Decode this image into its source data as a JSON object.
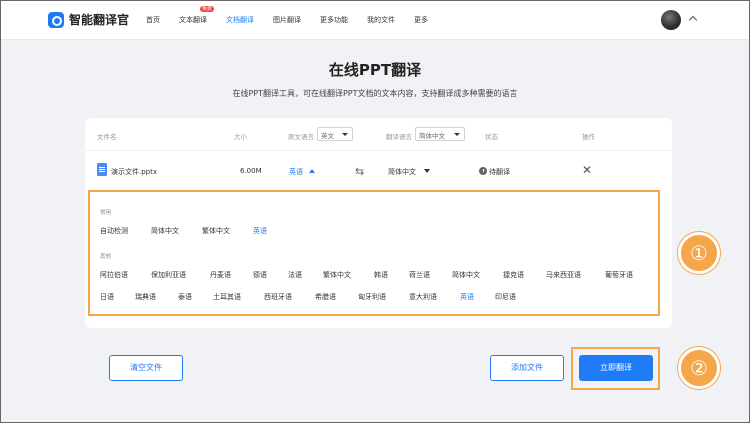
{
  "brand": {
    "name": "智能翻译官"
  },
  "nav": [
    {
      "label": "首页"
    },
    {
      "label": "文本翻译",
      "badge": "免费"
    },
    {
      "label": "文档翻译",
      "active": true
    },
    {
      "label": "图片翻译"
    },
    {
      "label": "更多功能"
    },
    {
      "label": "我的文件"
    },
    {
      "label": "更多"
    }
  ],
  "page": {
    "title": "在线PPT翻译",
    "subtitle": "在线PPT翻译工具，可在线翻译PPT文档的文本内容，支持翻译成多种需要的语言"
  },
  "table": {
    "headers": {
      "filename": "文件名",
      "size": "大小",
      "source_lang": "原文语言",
      "source_value": "英文",
      "target_lang": "翻译语言",
      "target_value": "简体中文",
      "status": "状态",
      "action": "操作"
    },
    "row": {
      "filename": "演示文件.pptx",
      "size": "6.00M",
      "source": "英语",
      "target": "简体中文",
      "status": "待翻译"
    }
  },
  "languages": {
    "common_label": "常用",
    "common": [
      "自动检测",
      "简体中文",
      "繁体中文",
      "英语"
    ],
    "other_label": "其他",
    "other_row1": [
      "阿拉伯语",
      "保加利亚语",
      "丹麦语",
      "德语",
      "法语",
      "繁体中文",
      "韩语",
      "荷兰语",
      "简体中文",
      "捷克语",
      "马来西亚语",
      "葡萄牙语"
    ],
    "other_row2": [
      "日语",
      "瑞典语",
      "泰语",
      "土耳其语",
      "西班牙语",
      "希腊语",
      "匈牙利语",
      "意大利语",
      "英语",
      "印尼语"
    ],
    "selected": "英语"
  },
  "actions": {
    "clear": "清空文件",
    "add": "添加文件",
    "translate": "立即翻译"
  },
  "markers": {
    "one": "①",
    "two": "②"
  },
  "colors": {
    "accent": "#1e7bf5",
    "highlight": "#f5a54a",
    "badge": "#f04438"
  }
}
